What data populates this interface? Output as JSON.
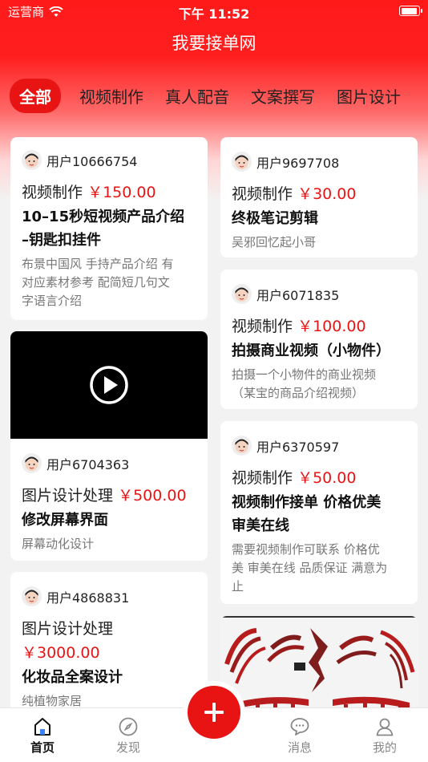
{
  "status_bar": {
    "carrier": "运营商",
    "time": "下午 11:52",
    "battery_level": 0.9
  },
  "header": {
    "title": "我要接单网"
  },
  "tabs": [
    "全部",
    "视频制作",
    "真人配音",
    "文案撰写",
    "图片设计"
  ],
  "active_tab": "全部",
  "cards": [
    {
      "user": "用户10666754",
      "category": "视频制作",
      "price": "￥150.00",
      "title_lines": [
        "10–15秒短视频产品介绍",
        "–钥匙扣挂件"
      ],
      "desc_lines": [
        "布景中国风 手持产品介绍 有",
        "对应素材参考 配简短几句文",
        "字语言介绍"
      ]
    },
    {
      "user": "用户9697708",
      "category": "视频制作",
      "price": "￥30.00",
      "title_lines": [
        "终极笔记剪辑"
      ],
      "desc_lines": [
        "吴邪回忆起小哥"
      ]
    },
    {
      "user": "用户6071835",
      "category": "视频制作",
      "price": "￥100.00",
      "title_lines": [
        "拍摄商业视频（小物件）"
      ],
      "desc_lines": [
        "拍摄一个小物件的商业视频",
        "（某宝的商品介绍视频）"
      ]
    },
    {
      "user": "用户6704363",
      "category": "图片设计处理",
      "price": "￥500.00",
      "title_lines": [
        "修改屏幕界面"
      ],
      "desc_lines": [
        "屏幕动化设计"
      ]
    },
    {
      "user": "用户6370597",
      "category": "视频制作",
      "price": "￥50.00",
      "title_lines": [
        "视频制作接单 价格优美",
        "审美在线"
      ],
      "desc_lines": [
        "需要视频制作可联系 价格优",
        "美 审美在线 品质保证 满意为",
        "止"
      ]
    },
    {
      "user": "用户4868831",
      "category": "图片设计处理",
      "price": "￥3000.00",
      "title_lines": [
        "化妆品全案设计"
      ],
      "desc_lines": [
        "纯植物家居"
      ]
    }
  ],
  "tabbar": {
    "home": "首页",
    "discover": "发现",
    "messages": "消息",
    "mine": "我的"
  },
  "colors": {
    "brand_red": "#e81414",
    "text_dark": "#111111",
    "text_gray": "#777777"
  }
}
